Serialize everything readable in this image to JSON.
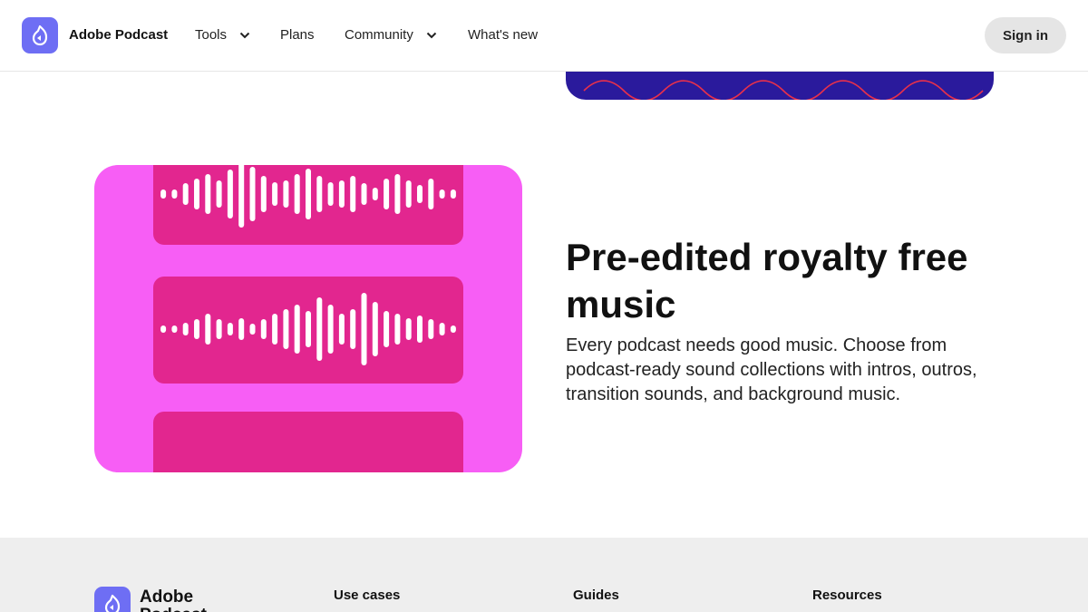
{
  "header": {
    "brand": "Adobe Podcast",
    "nav": {
      "tools": "Tools",
      "plans": "Plans",
      "community": "Community",
      "whats_new": "What's new"
    },
    "sign_in": "Sign in"
  },
  "feature": {
    "title": "Pre-edited royalty free music",
    "description": "Every podcast needs good music. Choose from podcast-ready sound collections with intros, outros, transition sounds, and background music."
  },
  "footer": {
    "brand": "Adobe Podcast",
    "columns": {
      "use_cases": "Use cases",
      "guides": "Guides",
      "resources": "Resources"
    }
  },
  "colors": {
    "brand_purple": "#6e6ef4",
    "card_pink": "#f75ef5",
    "panel_magenta": "#e2268f",
    "banner_indigo": "#2a1a9c"
  },
  "icons": {
    "logo": "podcast-mic-logo-icon",
    "dropdown": "chevron-down-icon"
  }
}
